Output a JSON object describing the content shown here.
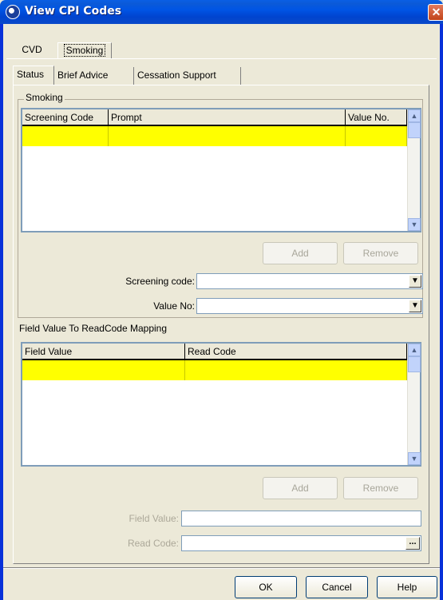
{
  "window": {
    "title": "View CPI Codes",
    "close_glyph": "✕"
  },
  "outer_tabs": [
    {
      "label": "CVD"
    },
    {
      "label": "Smoking"
    }
  ],
  "inner_tabs": [
    {
      "label": "Status"
    },
    {
      "label": "Brief Advice"
    },
    {
      "label": "Cessation Support"
    }
  ],
  "smoking_group": {
    "label": "Smoking",
    "grid": {
      "columns": [
        "Screening Code",
        "Prompt",
        "Value No."
      ],
      "rows": [
        [
          "",
          "",
          ""
        ]
      ]
    },
    "add_label": "Add",
    "remove_label": "Remove",
    "screening_code_label": "Screening code:",
    "screening_code_value": "",
    "value_no_label": "Value No:",
    "value_no_value": ""
  },
  "mapping": {
    "label": "Field Value To ReadCode Mapping",
    "grid": {
      "columns": [
        "Field Value",
        "Read Code"
      ],
      "rows": [
        [
          "",
          ""
        ]
      ]
    },
    "add_label": "Add",
    "remove_label": "Remove",
    "field_value_label": "Field Value:",
    "field_value_value": "",
    "read_code_label": "Read Code:",
    "read_code_value": "",
    "ellipsis_label": "..."
  },
  "footer": {
    "ok_label": "OK",
    "cancel_label": "Cancel",
    "help_label": "Help"
  },
  "colors": {
    "title_bar": "#0055e5",
    "selected_row": "#ffff00",
    "dialog_bg": "#ece9d8"
  }
}
